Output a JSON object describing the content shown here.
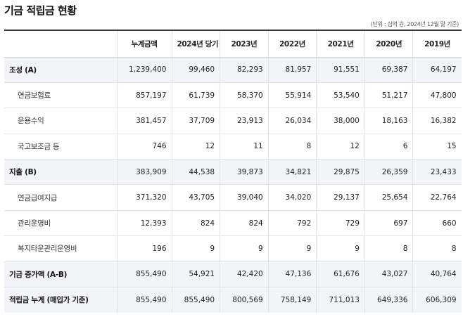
{
  "title": "기금 적립금 현황",
  "unit_note": "(단위 : 십억 원, 2024년 12월 말 기준)",
  "table": {
    "headers": [
      "",
      "누계금액",
      "2024년 당기",
      "2023년",
      "2022년",
      "2021년",
      "2020년",
      "2019년"
    ],
    "rows": [
      {
        "label": "조성 (A)",
        "values": [
          "1,239,400",
          "99,460",
          "82,293",
          "81,957",
          "91,551",
          "69,387",
          "64,197"
        ]
      },
      {
        "label": "연금보험료",
        "values": [
          "857,197",
          "61,739",
          "58,370",
          "55,914",
          "53,540",
          "51,217",
          "47,800"
        ]
      },
      {
        "label": "운용수익",
        "values": [
          "381,457",
          "37,709",
          "23,913",
          "26,034",
          "38,000",
          "18,163",
          "16,382"
        ]
      },
      {
        "label": "국고보조금 등",
        "values": [
          "746",
          "12",
          "11",
          "8",
          "12",
          "6",
          "15"
        ]
      },
      {
        "label": "지출 (B)",
        "values": [
          "383,909",
          "44,538",
          "39,873",
          "34,821",
          "29,875",
          "26,359",
          "23,433"
        ]
      },
      {
        "label": "연금급여지급",
        "values": [
          "371,320",
          "43,705",
          "39,040",
          "34,020",
          "29,137",
          "25,654",
          "22,764"
        ]
      },
      {
        "label": "관리운영비",
        "values": [
          "12,393",
          "824",
          "824",
          "792",
          "729",
          "697",
          "660"
        ]
      },
      {
        "label": "복지타운관리운영비",
        "values": [
          "196",
          "9",
          "9",
          "9",
          "9",
          "8",
          "8"
        ]
      },
      {
        "label": "기금 증가액 (A-B)",
        "values": [
          "855,490",
          "54,921",
          "42,420",
          "47,136",
          "61,676",
          "43,027",
          "40,764"
        ]
      },
      {
        "label": "적립금 누계 (매입가 기준)",
        "values": [
          "855,490",
          "855,490",
          "800,569",
          "758,149",
          "711,013",
          "649,336",
          "606,309"
        ]
      }
    ]
  },
  "colors": {
    "main_row_bg": "#f3f4f7",
    "top_rule": "#3a3a3a",
    "grid_line": "#e1e3e8"
  }
}
